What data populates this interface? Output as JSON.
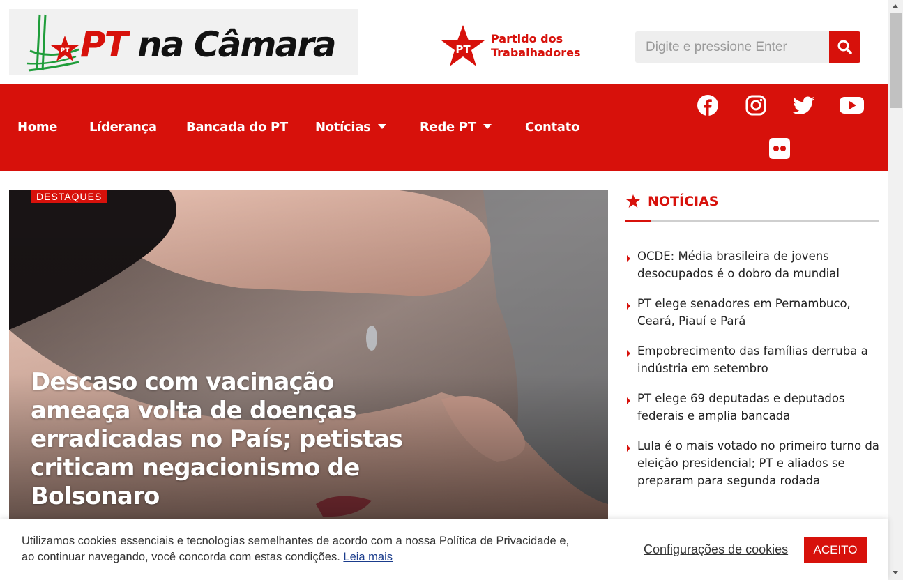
{
  "header": {
    "logo": {
      "brand_pt": "PT",
      "brand_rest": " na Câmara"
    },
    "party": {
      "line1": "Partido dos",
      "line2": "Trabalhadores",
      "star_label": "PT"
    },
    "search": {
      "placeholder": "Digite e pressione Enter"
    }
  },
  "nav": {
    "items": [
      {
        "label": "Home"
      },
      {
        "label": "Líderança"
      },
      {
        "label": "Bancada do PT"
      },
      {
        "label": "Notícias"
      },
      {
        "label": "Rede PT"
      },
      {
        "label": "Contato"
      }
    ],
    "social": [
      "facebook-icon",
      "instagram-icon",
      "twitter-icon",
      "youtube-icon",
      "flickr-icon"
    ]
  },
  "feature": {
    "badge": "DESTAQUES",
    "headline": "Descaso com vacinação ameaça volta de doenças erradicadas no País; petistas criticam negacionismo de Bolsonaro"
  },
  "sidebar": {
    "title": "NOTÍCIAS",
    "items": [
      "OCDE: Média brasileira de jovens desocupados é o dobro da mundial",
      "PT elege senadores em Pernambuco, Ceará, Piauí e Pará",
      "Empobrecimento das famílias derruba a indústria em setembro",
      "PT elege 69 deputadas e deputados federais e amplia bancada",
      "Lula é o mais votado no primeiro turno da eleição presidencial; PT e aliados se preparam para segunda rodada"
    ]
  },
  "cookie": {
    "text": "Utilizamos cookies essenciais e tecnologias semelhantes de acordo com a nossa Política de Privacidade e, ao continuar navegando, você concorda com estas condições.",
    "read_more": "Leia mais",
    "settings": "Configurações de cookies",
    "accept": "ACEITO"
  },
  "colors": {
    "brand_red": "#d7110b",
    "logo_green": "#1f9d3a"
  }
}
